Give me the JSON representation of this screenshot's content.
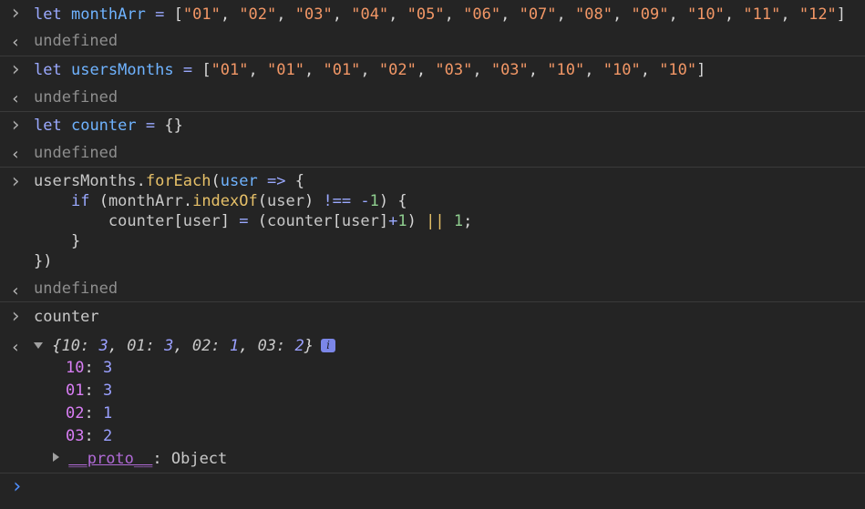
{
  "console": {
    "entries": [
      {
        "input": "let monthArr = [\"01\", \"02\", \"03\", \"04\", \"05\", \"06\", \"07\", \"08\", \"09\", \"10\", \"11\", \"12\"]",
        "output": "undefined"
      },
      {
        "input": "let usersMonths = [\"01\", \"01\", \"01\", \"02\", \"03\", \"03\", \"10\", \"10\", \"10\"]",
        "output": "undefined"
      },
      {
        "input": "let counter = {}",
        "output": "undefined"
      },
      {
        "input_lines": [
          "usersMonths.forEach(user => {",
          "    if (monthArr.indexOf(user) !== -1) {",
          "        counter[user] = (counter[user]+1) || 1;",
          "    }",
          "})"
        ],
        "output": "undefined"
      },
      {
        "input": "counter",
        "output_summary": "{10: 3, 01: 3, 02: 1, 03: 2}",
        "info_badge": "i",
        "properties": [
          {
            "key": "10",
            "value": "3"
          },
          {
            "key": "01",
            "value": "3"
          },
          {
            "key": "02",
            "value": "1"
          },
          {
            "key": "03",
            "value": "2"
          }
        ],
        "proto_key": "__proto__",
        "proto_value": "Object"
      }
    ],
    "prompt_icon": "chevron-right-icon"
  },
  "colors": {
    "background": "#242424",
    "keyword": "#9aa9ff",
    "variable": "#6fb3ff",
    "string": "#f29766",
    "function": "#e6c068",
    "undefined": "#8e8e8e",
    "property": "#d97ef5",
    "prompt": "#4f8fff"
  }
}
